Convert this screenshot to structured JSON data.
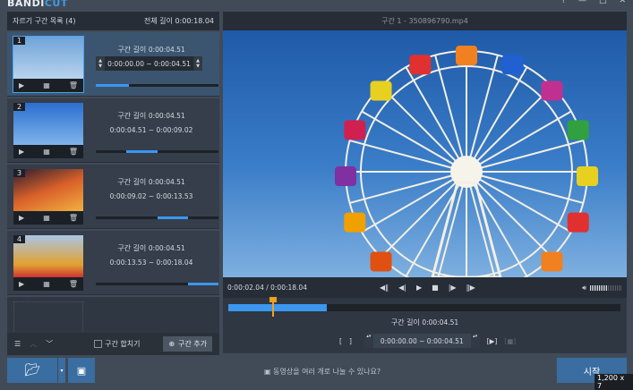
{
  "app": {
    "logo_a": "BANDI",
    "logo_b": "CUT",
    "win": [
      "▀",
      "?",
      "—",
      "□",
      "✕"
    ]
  },
  "left": {
    "title": "자르기 구간 목록",
    "count": "(4)",
    "total_label": "전체 길이",
    "total": "0:00:18.04",
    "items": [
      {
        "num": "1",
        "len_label": "구간 길이",
        "len": "0:00:04.51",
        "range": "0:00:00.00 ~ 0:00:04.51",
        "progress": 0.27
      },
      {
        "num": "2",
        "len_label": "구간 길이",
        "len": "0:00:04.51",
        "range": "0:00:04.51 ~ 0:00:09.02",
        "progress": 0.25
      },
      {
        "num": "3",
        "len_label": "구간 길이",
        "len": "0:00:04.51",
        "range": "0:00:09.02 ~ 0:00:13.53",
        "progress": 0.25
      },
      {
        "num": "4",
        "len_label": "구간 길이",
        "len": "0:00:04.51",
        "range": "0:00:13.53 ~ 0:00:18.04",
        "progress": 0.25
      }
    ],
    "merge_label": "구간 합치기",
    "add_label": "구간 추가"
  },
  "right": {
    "title": "구간 1",
    "file": "- 350896790.mp4",
    "time": "0:00:02.04 / 0:00:18.04",
    "len_label": "구간 길이",
    "len": "0:00:04.51",
    "start": "0:00:00.00",
    "end": "0:00:04.51",
    "sep": "~",
    "playhead": 0.113,
    "sel_end": 0.25,
    "volume": 0.55
  },
  "footer": {
    "help": "동영상을 여러 개로 나눌 수 있나요?",
    "start": "시작",
    "overlay": "1,200 x 7"
  }
}
